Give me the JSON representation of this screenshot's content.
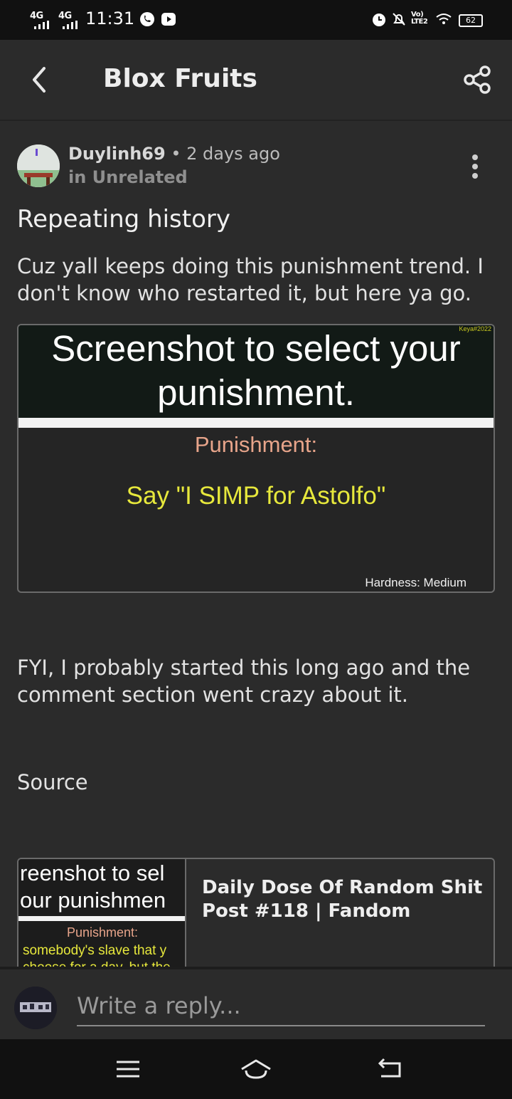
{
  "status_bar": {
    "signal_1": "4G",
    "signal_2": "4G",
    "time": "11:31",
    "volte_label": "Vo) LTE2",
    "battery": "62",
    "icons": [
      "call-icon",
      "youtube-icon",
      "alarm-icon",
      "mute-bell-icon",
      "wifi-icon",
      "battery-icon"
    ]
  },
  "app_bar": {
    "title": "Blox Fruits",
    "back_icon": "back-arrow-icon",
    "share_icon": "share-icon"
  },
  "post": {
    "author": "Duylinh69",
    "separator": "•",
    "posted_ago": "2 days ago",
    "category": "in Unrelated",
    "title": "Repeating history",
    "body_1": "Cuz yall keeps doing this punishment trend. I don't know who restarted it, but here ya go.",
    "image": {
      "header": "Screenshot to select your punishment.",
      "watermark": "Keya#2022",
      "label": "Punishment:",
      "punishment": "Say \"I SIMP for Astolfo\"",
      "hardness": "Hardness: Medium"
    },
    "body_2": "FYI, I probably started this long ago and the comment section went crazy about it.",
    "source_label": "Source",
    "link_card": {
      "thumb_line_1": "reenshot to sel",
      "thumb_line_2": "our punishmen",
      "thumb_label": "Punishment:",
      "thumb_text_1": "somebody's slave that y",
      "thumb_text_2": "choose for a day, but the",
      "title": "Daily Dose Of Random Shit Post #118 | Fandom"
    }
  },
  "reply": {
    "placeholder": "Write a reply..."
  },
  "nav_bar": {
    "icons": [
      "menu-icon",
      "home-icon",
      "back-icon"
    ]
  },
  "colors": {
    "background": "#2b2b2b",
    "status_bar": "#111111",
    "meme_yellow": "#e7e83c",
    "meme_salmon": "#e7a48a"
  }
}
